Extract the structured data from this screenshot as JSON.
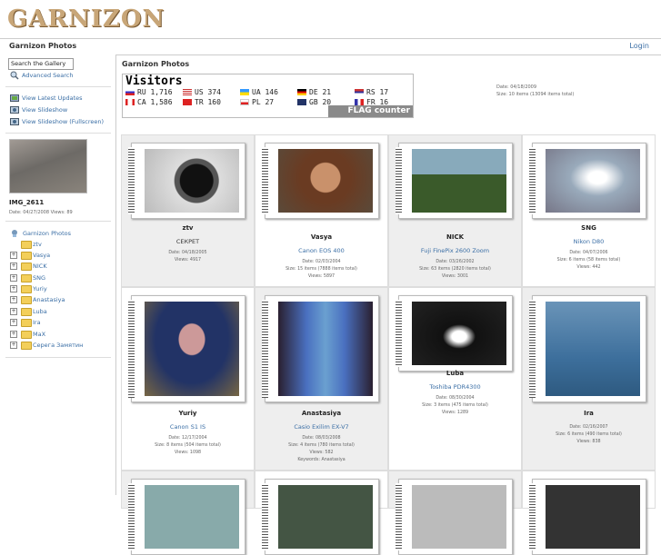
{
  "logo": "GARNIZON",
  "topbar": {
    "title": "Garnizon Photos",
    "login": "Login"
  },
  "sidebar": {
    "search_value": "Search the Gallery",
    "advanced_search": "Advanced Search",
    "links": [
      "View Latest Updates",
      "View Slideshow",
      "View Slideshow (Fullscreen)"
    ],
    "featured": {
      "title": "IMG_2611",
      "meta": "Date: 04/27/2008 Views: 89"
    },
    "tree_root": "Garnizon Photos",
    "tree": [
      "ztv",
      "Vasya",
      "NICK",
      "SNG",
      "Yuriy",
      "Anastasiya",
      "Luba",
      "Ira",
      "MaX",
      "Серега Замятин"
    ]
  },
  "main": {
    "title": "Garnizon Photos",
    "meta_date": "Date: 04/18/2009",
    "meta_size": "Size: 10 items (13094 items total)"
  },
  "flag_counter": {
    "heading": "Visitors",
    "badge": "FLAG counter",
    "entries": [
      {
        "code": "RU",
        "count": "1,716"
      },
      {
        "code": "US",
        "count": "374"
      },
      {
        "code": "UA",
        "count": "146"
      },
      {
        "code": "DE",
        "count": "21"
      },
      {
        "code": "RS",
        "count": "17"
      },
      {
        "code": "CA",
        "count": "1,586"
      },
      {
        "code": "TR",
        "count": "160"
      },
      {
        "code": "PL",
        "count": "27"
      },
      {
        "code": "GB",
        "count": "20"
      },
      {
        "code": "FR",
        "count": "16"
      }
    ]
  },
  "albums": [
    {
      "name": "ztv",
      "sub": "СЕКРЕТ",
      "sub_plain": true,
      "meta": [
        "Date: 04/18/2005",
        "Views: 4917"
      ]
    },
    {
      "name": "Vasya",
      "sub": "Canon EOS 400",
      "meta": [
        "Date: 02/03/2004",
        "Size: 15 items (7888 items total)",
        "Views: 5897"
      ]
    },
    {
      "name": "NICK",
      "sub": "Fuji FinePix 2600 Zoom",
      "meta": [
        "Date: 03/26/2002",
        "Size: 63 items (2820 items total)",
        "Views: 3001"
      ]
    },
    {
      "name": "SNG",
      "sub": "Nikon D80",
      "meta": [
        "Date: 04/07/2006",
        "Size: 6 items (58 items total)",
        "Views: 442"
      ]
    },
    {
      "name": "Yuriy",
      "sub": "Canon S1 IS",
      "meta": [
        "Date: 12/17/2004",
        "Size: 8 items (504 items total)",
        "Views: 1098"
      ]
    },
    {
      "name": "Anastasiya",
      "sub": "Casio Exilim EX-V7",
      "meta": [
        "Date: 08/03/2008",
        "Size: 4 items (780 items total)",
        "Views: 582",
        "Keywords: Anastasiya"
      ]
    },
    {
      "name": "Luba",
      "sub": "Toshiba PDR4300",
      "meta": [
        "Date: 08/30/2004",
        "Size: 3 items (475 items total)",
        "Views: 1289"
      ]
    },
    {
      "name": "Ira",
      "sub": "",
      "meta": [
        "Date: 02/16/2007",
        "Size: 6 items (490 items total)",
        "Views: 838"
      ]
    }
  ],
  "colors": {
    "link": "#3a6ea5",
    "logo": "#c8a678"
  }
}
